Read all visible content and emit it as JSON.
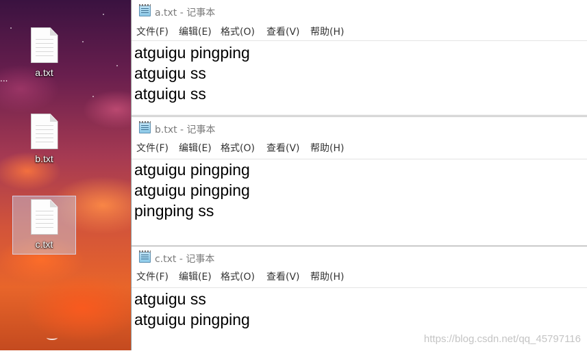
{
  "desktop": {
    "edge_text": "...",
    "icons": [
      {
        "label": "a.txt",
        "selected": false
      },
      {
        "label": "b.txt",
        "selected": false
      },
      {
        "label": "c.txt",
        "selected": true
      }
    ]
  },
  "windows": [
    {
      "title": "a.txt - 记事本",
      "menu": [
        "文件(F)",
        "编辑(E)",
        "格式(O)",
        "查看(V)",
        "帮助(H)"
      ],
      "lines": [
        "atguigu pingping",
        "atguigu ss",
        "atguigu ss"
      ]
    },
    {
      "title": "b.txt - 记事本",
      "menu": [
        "文件(F)",
        "编辑(E)",
        "格式(O)",
        "查看(V)",
        "帮助(H)"
      ],
      "lines": [
        "atguigu pingping",
        "atguigu pingping",
        "pingping ss"
      ]
    },
    {
      "title": "c.txt - 记事本",
      "menu": [
        "文件(F)",
        "编辑(E)",
        "格式(O)",
        "查看(V)",
        "帮助(H)"
      ],
      "lines": [
        "atguigu ss",
        "atguigu pingping"
      ]
    }
  ],
  "watermark": "https://blog.csdn.net/qq_45797116",
  "colors": {
    "title_text": "#7a7a7a",
    "selection": "#c8d2eb",
    "desktop_top": "#3a1240",
    "desktop_bottom": "#e8652a"
  }
}
